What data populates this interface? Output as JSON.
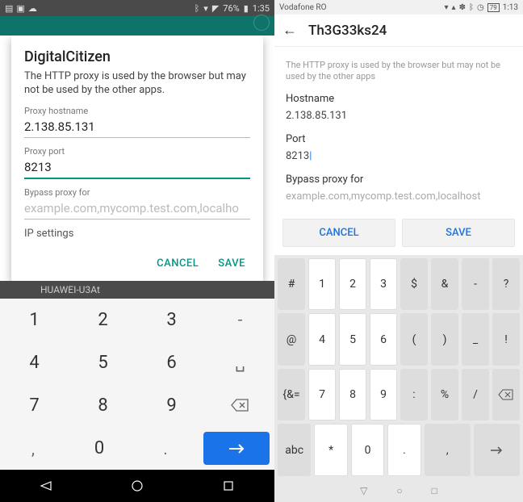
{
  "left": {
    "status": {
      "battery_percent": "76%",
      "time": "1:35"
    },
    "dialog": {
      "title": "DigitalCitizen",
      "subtitle": "The HTTP proxy is used by the browser but may not be used by the other apps.",
      "hostname_label": "Proxy hostname",
      "hostname_value": "2.138.85.131",
      "port_label": "Proxy port",
      "port_value": "8213",
      "bypass_label": "Bypass proxy for",
      "bypass_placeholder": "example.com,mycomp.test.com,localho",
      "ip_label": "IP settings",
      "cancel": "CANCEL",
      "save": "SAVE"
    },
    "bg_network": "HUAWEI-U3At",
    "keyboard": {
      "row1": [
        "1",
        "2",
        "3",
        "-"
      ],
      "row2": [
        "4",
        "5",
        "6",
        "␣"
      ],
      "row3": [
        "7",
        "8",
        "9",
        "⌫"
      ],
      "row4": [
        ",",
        "0",
        ".",
        "→"
      ]
    }
  },
  "right": {
    "status": {
      "carrier": "Vodafone RO",
      "battery_percent": "79",
      "time": "1:13"
    },
    "header": {
      "title": "Th3G33ks24"
    },
    "content": {
      "subtitle": "The HTTP proxy is used by the browser but may not be used by the other apps",
      "hostname_label": "Hostname",
      "hostname_value": "2.138.85.131",
      "port_label": "Port",
      "port_value": "8213",
      "bypass_label": "Bypass proxy for",
      "bypass_placeholder": "example.com,mycomp.test.com,localhost"
    },
    "actions": {
      "cancel": "CANCEL",
      "save": "SAVE"
    },
    "keyboard": {
      "row1": [
        "#",
        "1",
        "2",
        "3",
        "$",
        "&",
        "-",
        "?"
      ],
      "row2": [
        "@",
        "4",
        "5",
        "6",
        "(",
        ")",
        "_",
        "!"
      ],
      "row3": [
        "{&=",
        "7",
        "8",
        "9",
        ":",
        "%",
        "/",
        "⌫"
      ],
      "row4": [
        "abc",
        "*",
        "0",
        ".",
        ",",
        "→"
      ]
    }
  }
}
